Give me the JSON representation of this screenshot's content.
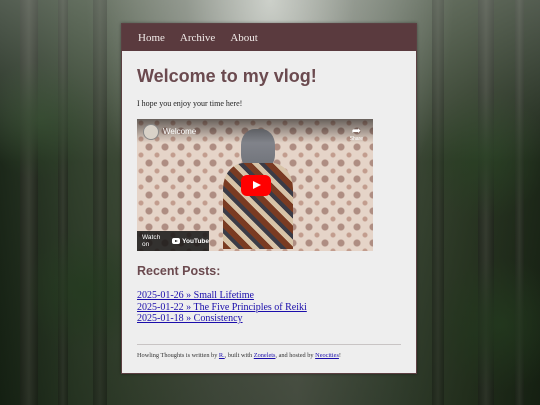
{
  "nav": {
    "items": [
      {
        "label": "Home"
      },
      {
        "label": "Archive"
      },
      {
        "label": "About"
      }
    ]
  },
  "main": {
    "title": "Welcome to my vlog!",
    "intro": "I hope you enjoy your time here!"
  },
  "video": {
    "title": "Welcome",
    "share_label": "Share",
    "watch_on": "Watch on",
    "youtube_label": "YouTube",
    "play_color": "#ff0000"
  },
  "recent": {
    "heading": "Recent Posts:",
    "posts": [
      {
        "label": "2025-01-26 » Small Lifetime"
      },
      {
        "label": "2025-01-22 » The Five Principles of Reiki"
      },
      {
        "label": "2025-01-18 » Consistency"
      }
    ]
  },
  "footer": {
    "text_1": "Howling Thoughts is written by ",
    "author": "R.",
    "text_2": ", built with ",
    "builder": "Zonelets",
    "text_3": ", and hosted by ",
    "host": "Neocities",
    "text_4": "!"
  },
  "colors": {
    "nav_bg": "#5a3a3e",
    "heading": "#6b4a4f",
    "link": "#1a0dab",
    "panel_bg": "#eeeeee"
  }
}
